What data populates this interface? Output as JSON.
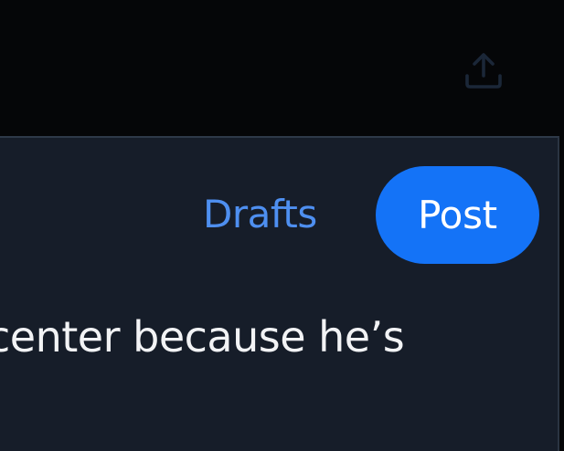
{
  "header": {
    "share_icon": "share-upload-icon"
  },
  "composer": {
    "drafts_label": "Drafts",
    "post_label": "Post",
    "text": "center because he’s"
  },
  "colors": {
    "background_top": "#050608",
    "composer_bg": "#161d29",
    "accent": "#1473f7",
    "link": "#4e8ff0",
    "text": "#f2f3f5"
  }
}
